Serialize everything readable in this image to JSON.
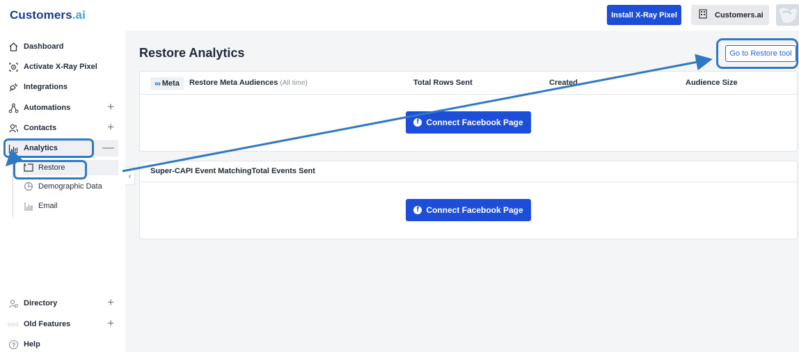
{
  "header": {
    "logo_main": "Customers",
    "logo_suffix": ".ai",
    "install_label": "Install X-Ray Pixel",
    "account_label": "Customers.ai"
  },
  "sidebar": {
    "items": [
      {
        "label": "Dashboard",
        "icon": "home-icon"
      },
      {
        "label": "Activate X-Ray Pixel",
        "icon": "target-icon"
      },
      {
        "label": "Integrations",
        "icon": "plug-icon"
      },
      {
        "label": "Automations",
        "icon": "flow-icon"
      },
      {
        "label": "Contacts",
        "icon": "users-icon"
      },
      {
        "label": "Analytics",
        "icon": "bar-chart-icon"
      }
    ],
    "sub_items": [
      {
        "label": "Restore",
        "icon": "restore-icon"
      },
      {
        "label": "Demographic Data",
        "icon": "pie-chart-icon"
      },
      {
        "label": "Email",
        "icon": "bar-chart-icon"
      }
    ],
    "bottom_items": [
      {
        "label": "Directory",
        "icon": "directory-icon"
      },
      {
        "label": "Old Features",
        "icon": "dots-icon"
      },
      {
        "label": "Help",
        "icon": "help-icon"
      }
    ]
  },
  "main": {
    "title": "Restore Analytics",
    "restore_tool_label": "Go to Restore tool",
    "meta_card": {
      "logo_text": "Meta",
      "title": "Restore Meta Audiences",
      "title_note": "(All time)",
      "columns": [
        "Total Rows Sent",
        "Created",
        "Audience Size"
      ],
      "connect_label": "Connect Facebook Page"
    },
    "capi_card": {
      "header": "Super-CAPI Event MatchingTotal Events Sent",
      "connect_label": "Connect Facebook Page"
    }
  },
  "colors": {
    "primary": "#1d4ed8",
    "annotation": "#2f78c4",
    "brand_dark": "#1a3a8f",
    "brand_light": "#3aa0e8"
  }
}
